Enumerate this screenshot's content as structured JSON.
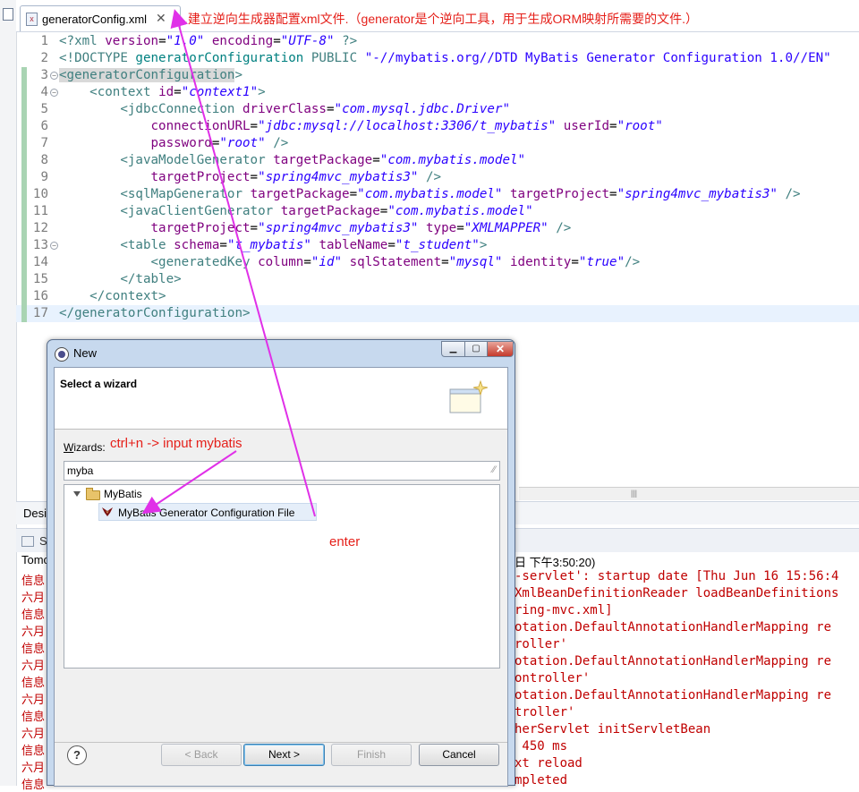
{
  "editor": {
    "tab_label": "generatorConfig.xml",
    "tab_close": "✕",
    "annotation": ".建立逆向生成器配置xml文件.（generator是个逆向工具，用于生成ORM映射所需要的文件.）",
    "code_lines": [
      {
        "num": "1",
        "html": "<span class=\"k\">&lt;?xml</span> <span class=\"a\">version</span>=<span class=\"v\">\"1.0\"</span> <span class=\"a\">encoding</span>=<span class=\"v\">\"UTF-8\"</span> <span class=\"k\">?&gt;</span>"
      },
      {
        "num": "2",
        "html": "<span class=\"k\">&lt;!DOCTYPE</span> <span class=\"p\">generatorConfiguration</span> <span class=\"k\">PUBLIC</span> <span class=\"v\" style=\"font-style:normal\">\"-//mybatis.org//DTD MyBatis Generator Configuration 1.0//EN\"</span>"
      },
      {
        "num": "3",
        "fold": true,
        "html": "<span class=\"t hlword\">&lt;generatorConfiguration</span><span class=\"t\">&gt;</span>"
      },
      {
        "num": "4",
        "fold": true,
        "html": "    <span class=\"t\">&lt;context</span> <span class=\"a\">id</span>=<span class=\"v\">\"context1\"</span><span class=\"t\">&gt;</span>"
      },
      {
        "num": "5",
        "html": "        <span class=\"t\">&lt;jdbcConnection</span> <span class=\"a\">driverClass</span>=<span class=\"v\">\"com.mysql.jdbc.Driver\"</span>"
      },
      {
        "num": "6",
        "html": "            <span class=\"a\">connectionURL</span>=<span class=\"v\">\"jdbc:mysql://localhost:3306/t_mybatis\"</span> <span class=\"a\">userId</span>=<span class=\"v\">\"root\"</span>"
      },
      {
        "num": "7",
        "html": "            <span class=\"a\">password</span>=<span class=\"v\">\"root\"</span> <span class=\"t\">/&gt;</span>"
      },
      {
        "num": "8",
        "html": "        <span class=\"t\">&lt;javaModelGenerator</span> <span class=\"a\">targetPackage</span>=<span class=\"v\">\"com.mybatis.model\"</span>"
      },
      {
        "num": "9",
        "html": "            <span class=\"a\">targetProject</span>=<span class=\"v\">\"spring4mvc_mybatis3\"</span> <span class=\"t\">/&gt;</span>"
      },
      {
        "num": "10",
        "html": "        <span class=\"t\">&lt;sqlMapGenerator</span> <span class=\"a\">targetPackage</span>=<span class=\"v\">\"com.mybatis.model\"</span> <span class=\"a\">targetProject</span>=<span class=\"v\">\"spring4mvc_mybatis3\"</span> <span class=\"t\">/&gt;</span>"
      },
      {
        "num": "11",
        "html": "        <span class=\"t\">&lt;javaClientGenerator</span> <span class=\"a\">targetPackage</span>=<span class=\"v\">\"com.mybatis.model\"</span>"
      },
      {
        "num": "12",
        "html": "            <span class=\"a\">targetProject</span>=<span class=\"v\">\"spring4mvc_mybatis3\"</span> <span class=\"a\">type</span>=<span class=\"v\">\"XMLMAPPER\"</span> <span class=\"t\">/&gt;</span>"
      },
      {
        "num": "13",
        "fold": true,
        "html": "        <span class=\"t\">&lt;table</span> <span class=\"a\">schema</span>=<span class=\"v\">\"t_mybatis\"</span> <span class=\"a\">tableName</span>=<span class=\"v\">\"t_student\"</span><span class=\"t\">&gt;</span>"
      },
      {
        "num": "14",
        "html": "            <span class=\"t\">&lt;generatedKey</span> <span class=\"a\">column</span>=<span class=\"v\">\"id\"</span> <span class=\"a\">sqlStatement</span>=<span class=\"v\">\"mysql\"</span> <span class=\"a\">identity</span>=<span class=\"v\">\"true\"</span><span class=\"t\">/&gt;</span>"
      },
      {
        "num": "15",
        "html": "        <span class=\"t\">&lt;/table&gt;</span>"
      },
      {
        "num": "16",
        "html": "    <span class=\"t\">&lt;/context&gt;</span>"
      },
      {
        "num": "17",
        "hl": true,
        "html": "<span class=\"t\">&lt;/generatorConfiguration&gt;</span>"
      }
    ]
  },
  "console": {
    "design_tab": "Desi",
    "console_tab": "S",
    "tomcat_left": "Tomc",
    "tomcat_right": "日 下午3:50:20)",
    "left_lines": [
      "信息",
      "六月",
      "信息",
      "六月",
      "信息",
      "六月",
      "信息",
      "六月",
      "信息",
      "六月",
      "信息",
      "六月",
      "信息"
    ],
    "right_lines": [
      "-servlet': startup date [Thu Jun 16 15:56:4",
      "XmlBeanDefinitionReader loadBeanDefinitions",
      "ring-mvc.xml]",
      "otation.DefaultAnnotationHandlerMapping re",
      "roller'",
      "otation.DefaultAnnotationHandlerMapping re",
      "ontroller'",
      "otation.DefaultAnnotationHandlerMapping re",
      "troller'",
      "herServlet initServletBean",
      " 450 ms",
      "xt reload",
      "mpleted"
    ]
  },
  "dialog": {
    "title": "New",
    "header_title": "Select a wizard",
    "wizards_label_prefix": "W",
    "wizards_label_rest": "izards:",
    "annotation_ctrl": "ctrl+n -> input mybatis",
    "filter_value": "myba",
    "tree_folder": "MyBatis",
    "tree_item": "MyBatis Generator Configuration File",
    "annotation_enter": "enter",
    "buttons": {
      "back": "< Back",
      "next": "Next >",
      "finish": "Finish",
      "cancel": "Cancel"
    },
    "help": "?"
  },
  "colors": {
    "annotation": "#e5201a",
    "arrow": "#e030e8",
    "console_error": "#c00000"
  }
}
